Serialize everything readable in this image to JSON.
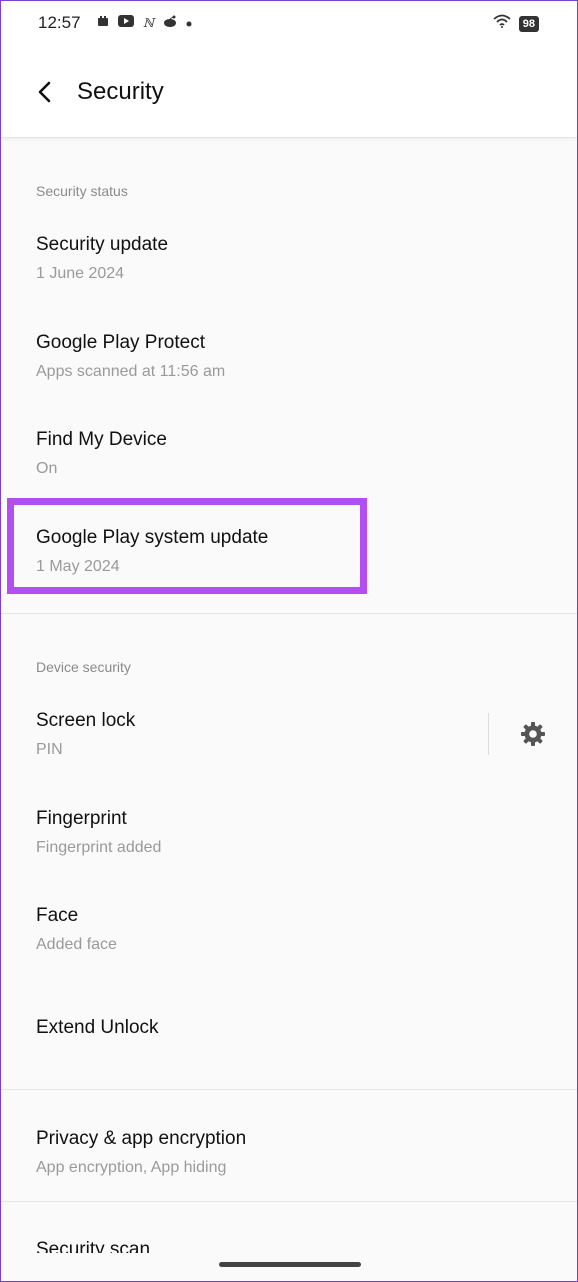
{
  "status_bar": {
    "time": "12:57",
    "battery": "98",
    "icons": [
      "notification-icon",
      "youtube-icon",
      "app-icon",
      "reddit-icon",
      "dot-icon"
    ]
  },
  "header": {
    "title": "Security"
  },
  "sections": [
    {
      "label": "Security status",
      "items": [
        {
          "title": "Security update",
          "subtitle": "1 June 2024"
        },
        {
          "title": "Google Play Protect",
          "subtitle": "Apps scanned at 11:56 am"
        },
        {
          "title": "Find My Device",
          "subtitle": "On"
        },
        {
          "title": "Google Play system update",
          "subtitle": "1 May 2024"
        }
      ]
    },
    {
      "label": "Device security",
      "items": [
        {
          "title": "Screen lock",
          "subtitle": "PIN"
        },
        {
          "title": "Fingerprint",
          "subtitle": "Fingerprint added"
        },
        {
          "title": "Face",
          "subtitle": "Added face"
        },
        {
          "title": "Extend Unlock"
        }
      ]
    },
    {
      "items": [
        {
          "title": "Privacy & app encryption",
          "subtitle": "App encryption, App hiding"
        },
        {
          "title": "Security scan"
        }
      ]
    }
  ],
  "colors": {
    "highlight": "#b44ef0",
    "accent_border": "#7a3fd6"
  }
}
